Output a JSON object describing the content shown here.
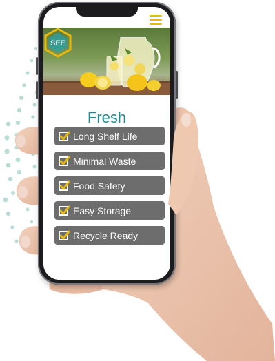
{
  "header": {
    "menu_icon": "hamburger-menu-icon"
  },
  "hero": {
    "logo_text": "SEE",
    "image": "lemonade-jar-and-lemons"
  },
  "title": "Fresh",
  "features": [
    {
      "label": "Long Shelf Life",
      "icon": "checkbox-checked-icon"
    },
    {
      "label": "Minimal Waste",
      "icon": "checkbox-checked-icon"
    },
    {
      "label": "Food Safety",
      "icon": "checkbox-checked-icon"
    },
    {
      "label": "Easy Storage",
      "icon": "checkbox-checked-icon"
    },
    {
      "label": "Recycle Ready",
      "icon": "checkbox-checked-icon"
    }
  ],
  "colors": {
    "accent": "#e9b90e",
    "title": "#1f8a8e",
    "feature_bg": "#6d6d6d"
  }
}
